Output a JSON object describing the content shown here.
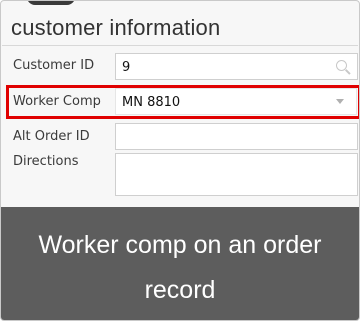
{
  "panel": {
    "title": "customer information"
  },
  "fields": [
    {
      "label": "Customer ID",
      "value": "9",
      "icon": "search-icon"
    },
    {
      "label": "Worker Comp",
      "value": "MN 8810",
      "icon": "chevron-down-icon"
    },
    {
      "label": "Alt Order ID",
      "value": ""
    },
    {
      "label": "Directions",
      "value": ""
    }
  ],
  "caption": {
    "text": "Worker comp on an order record"
  },
  "colors": {
    "highlight": "#e00000",
    "caption_bg": "#5d5d5d"
  }
}
